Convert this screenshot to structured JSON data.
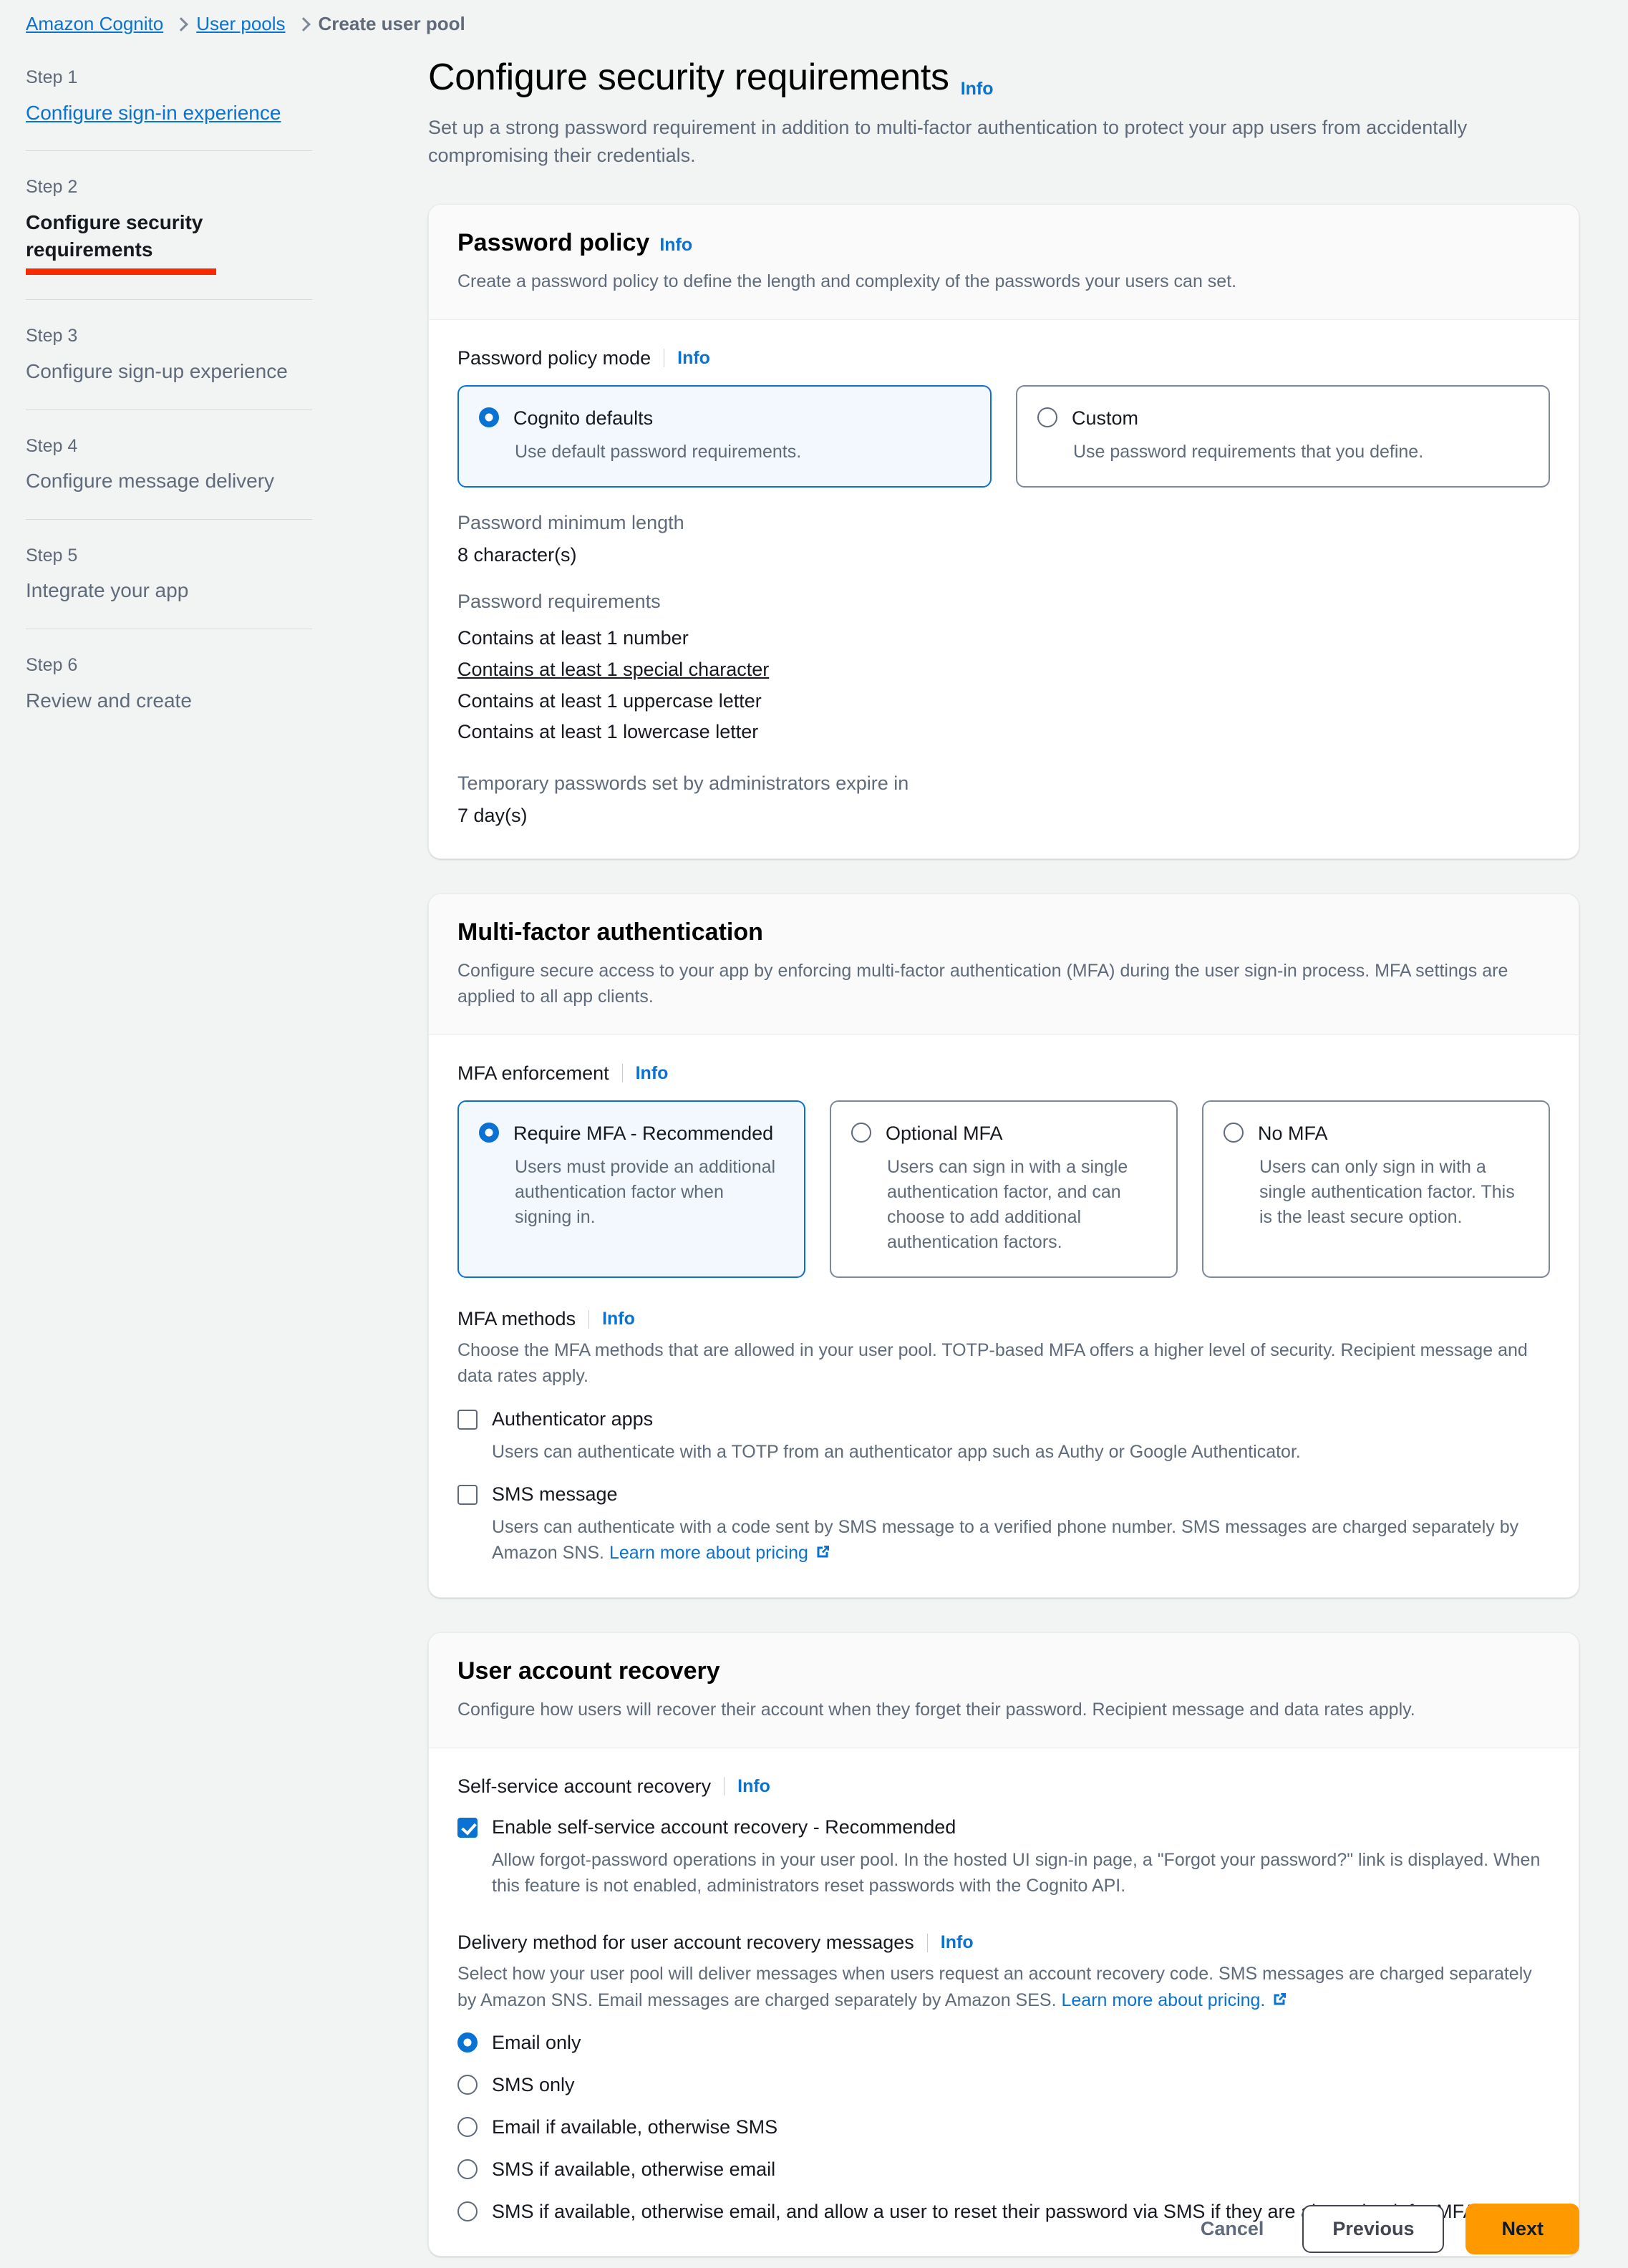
{
  "breadcrumb": {
    "items": [
      {
        "label": "Amazon Cognito",
        "type": "link"
      },
      {
        "label": "User pools",
        "type": "link"
      },
      {
        "label": "Create user pool",
        "type": "current"
      }
    ]
  },
  "sidebar": {
    "steps": [
      {
        "num": "Step 1",
        "title": "Configure sign-in experience",
        "state": "link"
      },
      {
        "num": "Step 2",
        "title": "Configure security requirements",
        "state": "current"
      },
      {
        "num": "Step 3",
        "title": "Configure sign-up experience",
        "state": "upcoming"
      },
      {
        "num": "Step 4",
        "title": "Configure message delivery",
        "state": "upcoming"
      },
      {
        "num": "Step 5",
        "title": "Integrate your app",
        "state": "upcoming"
      },
      {
        "num": "Step 6",
        "title": "Review and create",
        "state": "upcoming"
      }
    ]
  },
  "page": {
    "title": "Configure security requirements",
    "info_label": "Info",
    "description": "Set up a strong password requirement in addition to multi-factor authentication to protect your app users from accidentally compromising their credentials."
  },
  "password_policy": {
    "title": "Password policy",
    "info_label": "Info",
    "description": "Create a password policy to define the length and complexity of the passwords your users can set.",
    "mode_label": "Password policy mode",
    "mode_info_label": "Info",
    "modes": [
      {
        "label": "Cognito defaults",
        "desc": "Use default password requirements.",
        "selected": true
      },
      {
        "label": "Custom",
        "desc": "Use password requirements that you define.",
        "selected": false
      }
    ],
    "min_length_label": "Password minimum length",
    "min_length_value": "8 character(s)",
    "requirements_label": "Password requirements",
    "requirements": [
      "Contains at least 1 number",
      "Contains at least 1 special character",
      "Contains at least 1 uppercase letter",
      "Contains at least 1 lowercase letter"
    ],
    "temp_password_label": "Temporary passwords set by administrators expire in",
    "temp_password_value": "7 day(s)"
  },
  "mfa": {
    "title": "Multi-factor authentication",
    "description": "Configure secure access to your app by enforcing multi-factor authentication (MFA) during the user sign-in process. MFA settings are applied to all app clients.",
    "enforcement_label": "MFA enforcement",
    "enforcement_info_label": "Info",
    "enforcement_options": [
      {
        "label": "Require MFA - Recommended",
        "desc": "Users must provide an additional authentication factor when signing in.",
        "selected": true
      },
      {
        "label": "Optional MFA",
        "desc": "Users can sign in with a single authentication factor, and can choose to add additional authentication factors.",
        "selected": false
      },
      {
        "label": "No MFA",
        "desc": "Users can only sign in with a single authentication factor. This is the least secure option.",
        "selected": false
      }
    ],
    "methods_label": "MFA methods",
    "methods_info_label": "Info",
    "methods_help": "Choose the MFA methods that are allowed in your user pool. TOTP-based MFA offers a higher level of security. Recipient message and data rates apply.",
    "methods": [
      {
        "label": "Authenticator apps",
        "desc": "Users can authenticate with a TOTP from an authenticator app such as Authy or Google Authenticator.",
        "checked": false
      },
      {
        "label": "SMS message",
        "desc_pre": "Users can authenticate with a code sent by SMS message to a verified phone number. SMS messages are charged separately by Amazon SNS. ",
        "desc_link": "Learn more about pricing",
        "checked": false
      }
    ]
  },
  "recovery": {
    "title": "User account recovery",
    "description": "Configure how users will recover their account when they forget their password. Recipient message and data rates apply.",
    "self_service_label": "Self-service account recovery",
    "self_service_info_label": "Info",
    "self_service_checkbox": {
      "label": "Enable self-service account recovery - Recommended",
      "desc": "Allow forgot-password operations in your user pool. In the hosted UI sign-in page, a \"Forgot your password?\" link is displayed. When this feature is not enabled, administrators reset passwords with the Cognito API.",
      "checked": true
    },
    "delivery_label": "Delivery method for user account recovery messages",
    "delivery_info_label": "Info",
    "delivery_help_pre": "Select how your user pool will deliver messages when users request an account recovery code. SMS messages are charged separately by Amazon SNS. Email messages are charged separately by Amazon SES. ",
    "delivery_help_link": "Learn more about pricing.",
    "delivery_options": [
      {
        "label": "Email only",
        "selected": true
      },
      {
        "label": "SMS only",
        "selected": false
      },
      {
        "label": "Email if available, otherwise SMS",
        "selected": false
      },
      {
        "label": "SMS if available, otherwise email",
        "selected": false
      },
      {
        "label": "SMS if available, otherwise email, and allow a user to reset their password via SMS if they are also using it for MFA",
        "selected": false
      }
    ]
  },
  "footer": {
    "cancel_label": "Cancel",
    "previous_label": "Previous",
    "next_label": "Next"
  },
  "colors": {
    "accent_blue": "#0972d3",
    "primary_orange": "#ff9900",
    "highlight_red": "#fa2a00",
    "muted_text": "#5f6b7a"
  }
}
